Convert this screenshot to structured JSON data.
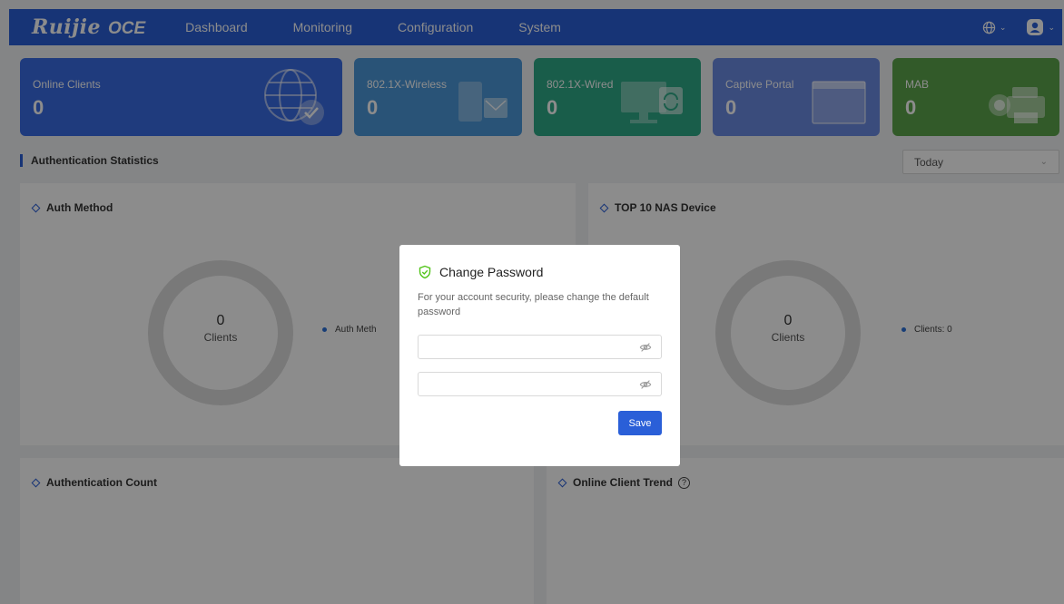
{
  "brand": {
    "name": "Ruijie",
    "product": "OCE"
  },
  "nav": {
    "items": [
      "Dashboard",
      "Monitoring",
      "Configuration",
      "System"
    ]
  },
  "cards": [
    {
      "label": "Online Clients",
      "value": "0"
    },
    {
      "label": "802.1X-Wireless",
      "value": "0"
    },
    {
      "label": "802.1X-Wired",
      "value": "0"
    },
    {
      "label": "Captive Portal",
      "value": "0"
    },
    {
      "label": "MAB",
      "value": "0"
    }
  ],
  "section": {
    "title": "Authentication Statistics"
  },
  "filter": {
    "selected": "Today"
  },
  "panels": {
    "auth_method": {
      "title": "Auth Method",
      "center_value": "0",
      "center_label": "Clients",
      "legend": "Auth Meth"
    },
    "top_nas": {
      "title": "TOP 10 NAS Device",
      "center_value": "0",
      "center_label": "Clients",
      "legend": "Clients: 0"
    },
    "auth_count": {
      "title": "Authentication Count"
    },
    "online_trend": {
      "title": "Online Client Trend",
      "help": "?"
    }
  },
  "modal": {
    "title": "Change Password",
    "description": "For your account security, please change the default password",
    "new_password_placeholder": "",
    "confirm_password_placeholder": "",
    "save_label": "Save"
  },
  "colors": {
    "accent": "#2a5fd8",
    "card_online": "#3a6ce3",
    "card_wireless": "#4c98d9",
    "card_wired": "#2fa988",
    "card_portal": "#6a8ae2",
    "card_mab": "#5ba54c",
    "success": "#52c41a"
  }
}
